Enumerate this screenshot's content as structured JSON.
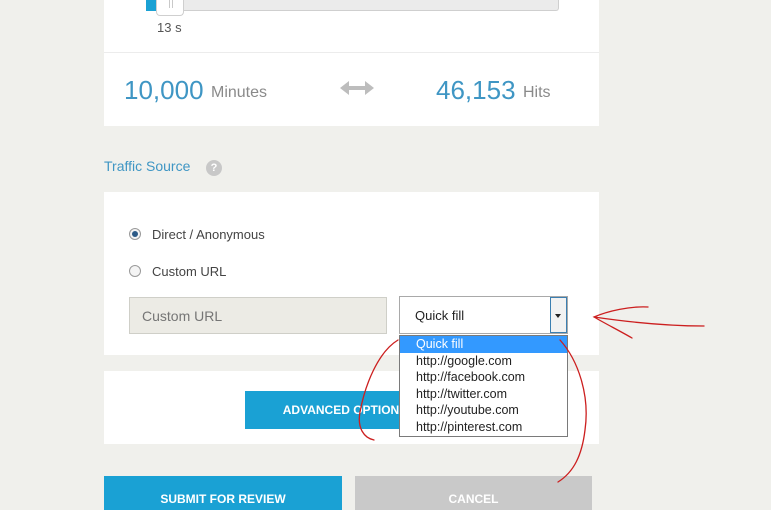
{
  "slider": {
    "value_label": "13 s",
    "level": 0.02
  },
  "stats": {
    "minutes_value": "10,000",
    "minutes_unit": "Minutes",
    "hits_value": "46,153",
    "hits_unit": "Hits",
    "swap_icon": "double-arrow-icon"
  },
  "traffic_source": {
    "title": "Traffic Source",
    "help_icon": "question-icon",
    "help_glyph": "?",
    "options": [
      {
        "label": "Direct / Anonymous",
        "checked": true
      },
      {
        "label": "Custom URL",
        "checked": false
      }
    ],
    "custom_url_placeholder": "Custom URL",
    "quick_fill": {
      "selected": "Quick fill",
      "items": [
        "Quick fill",
        "http://google.com",
        "http://facebook.com",
        "http://twitter.com",
        "http://youtube.com",
        "http://pinterest.com"
      ]
    }
  },
  "buttons": {
    "advanced_options": "ADVANCED OPTIONS",
    "submit": "SUBMIT FOR REVIEW",
    "cancel": "CANCEL"
  },
  "colors": {
    "accent": "#1aa1d4",
    "number": "#3f96c4",
    "annotation": "#cc1f1f"
  }
}
